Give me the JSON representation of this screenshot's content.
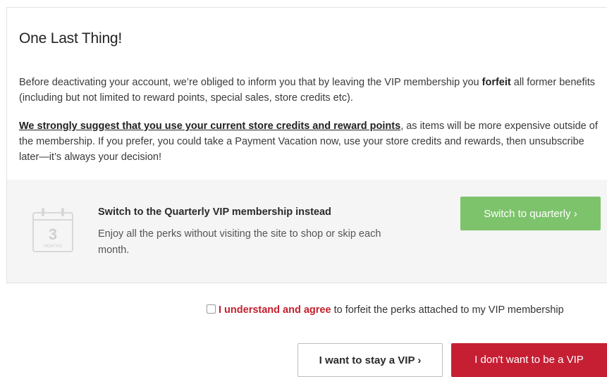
{
  "dialog": {
    "title": "One Last Thing!",
    "paragraph1": {
      "before": "Before deactivating your account, we’re obliged to inform you that by leaving the VIP membership you ",
      "bold": "forfeit",
      "after": " all former benefits (including but not limited to reward points, special sales, store credits etc)."
    },
    "paragraph2": {
      "emphasis": "We strongly suggest that you use your current store credits and reward points",
      "rest": ", as items will be more expensive outside of the membership. If you prefer, you could take a Payment Vacation now, use your store credits and rewards, then unsubscribe later—it’s always your decision!"
    }
  },
  "offer": {
    "icon": "calendar-icon",
    "calendar_number": "3",
    "calendar_label": "MONTHS",
    "title": "Switch to the Quarterly VIP membership instead",
    "description": "Enjoy all the perks without visiting the site to shop or skip each month.",
    "button_label": "Switch to quarterly ›",
    "button_color": "#7dc36b"
  },
  "agreement": {
    "checked": false,
    "highlight": "I understand and agree",
    "rest": " to forfeit the perks attached to my VIP membership",
    "highlight_color": "#c4202e"
  },
  "actions": {
    "stay_label": "I want to stay a VIP ›",
    "leave_label": "I don't want to be a VIP",
    "leave_color": "#c61f34"
  }
}
